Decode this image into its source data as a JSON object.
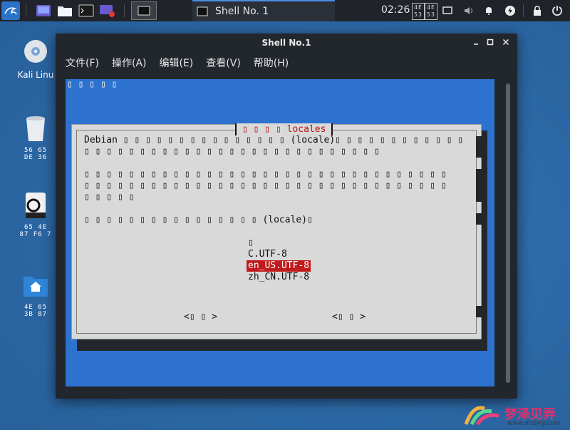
{
  "taskbar": {
    "active_task_label": "Shell No. 1",
    "clock": "02:26",
    "clock_glyphs": "4E\n53",
    "colors": {
      "panel": "#20232a",
      "accent": "#4a90e2"
    }
  },
  "desktop": {
    "icons": [
      {
        "label": "Kali Linu",
        "icon": "disc-icon"
      },
      {
        "label": "56 65\nDE 36",
        "icon": "trash-icon"
      },
      {
        "label": "65 4E\n87 F6 7",
        "icon": "drive-icon"
      },
      {
        "label": "4E 65\n3B 87",
        "icon": "home-folder-icon"
      }
    ]
  },
  "window": {
    "title": "Shell No.1",
    "menu": [
      {
        "label": "文件(F)"
      },
      {
        "label": "操作(A)"
      },
      {
        "label": "编辑(E)"
      },
      {
        "label": "查看(V)"
      },
      {
        "label": "帮助(H)"
      }
    ]
  },
  "terminal": {
    "header_glyphs": "▯ ▯ ▯ ▯ ▯"
  },
  "dialog": {
    "title": "▯ ▯ ▯ ▯  locales",
    "line1": "Debian ▯ ▯ ▯ ▯ ▯ ▯ ▯ ▯ ▯ ▯ ▯ ▯ ▯ ▯ ▯ (locale)▯ ▯ ▯ ▯ ▯ ▯ ▯ ▯ ▯ ▯ ▯ ▯",
    "line2": "▯ ▯ ▯ ▯ ▯ ▯ ▯ ▯ ▯ ▯ ▯ ▯ ▯ ▯ ▯ ▯ ▯ ▯ ▯ ▯ ▯ ▯ ▯ ▯ ▯ ▯ ▯",
    "line3": "▯ ▯ ▯ ▯ ▯ ▯ ▯ ▯ ▯ ▯ ▯ ▯ ▯ ▯ ▯ ▯ ▯ ▯ ▯ ▯ ▯ ▯ ▯ ▯ ▯ ▯ ▯ ▯ ▯ ▯ ▯ ▯ ▯",
    "line4": "▯ ▯ ▯ ▯ ▯ ▯ ▯ ▯ ▯ ▯ ▯ ▯ ▯ ▯ ▯ ▯ ▯ ▯ ▯ ▯ ▯ ▯ ▯ ▯ ▯ ▯ ▯ ▯ ▯ ▯ ▯ ▯ ▯",
    "line5": "▯ ▯ ▯ ▯ ▯",
    "line6": "▯ ▯ ▯ ▯ ▯ ▯ ▯ ▯ ▯ ▯ ▯ ▯ ▯ ▯ ▯ ▯ (locale)▯",
    "options": {
      "none": "▯",
      "c_utf8": "C.UTF-8",
      "en_us": "en_US.UTF-8",
      "zh_cn": "zh_CN.UTF-8"
    },
    "selected_option": "en_US.UTF-8",
    "ok_button": "<▯ ▯ >",
    "cancel_button": "<▯ ▯ >",
    "colors": {
      "title": "#c01010",
      "selection": "#c01a1a",
      "background": "#d9d9d9",
      "terminal": "#2e72cf"
    }
  },
  "watermark": {
    "text": "梦泽见弄",
    "url": "www.mzbky.com"
  }
}
